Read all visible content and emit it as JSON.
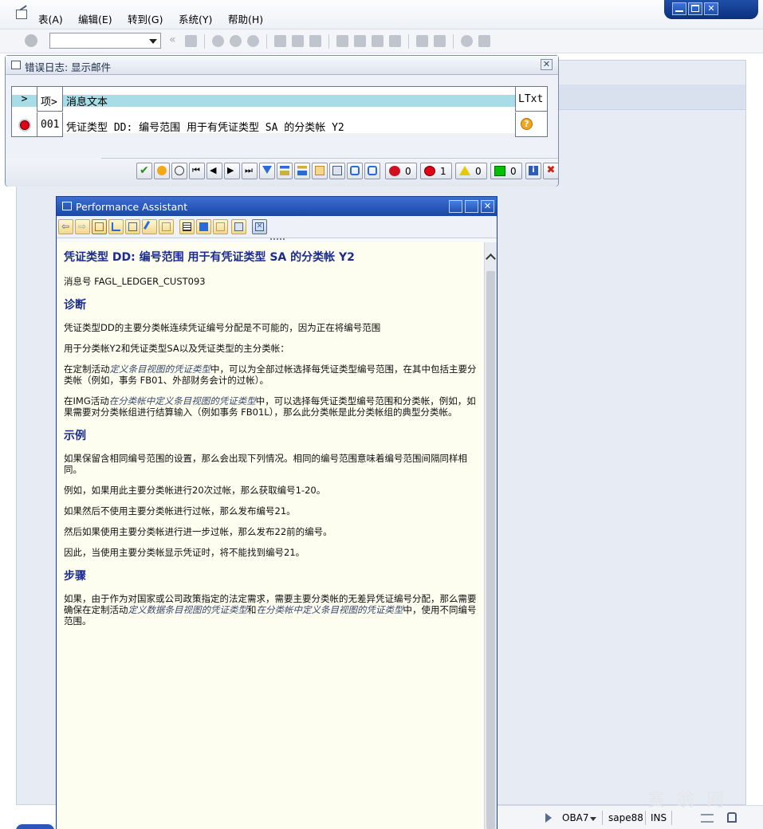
{
  "menubar": {
    "items": [
      "表(A)",
      "编辑(E)",
      "转到(G)",
      "系统(Y)",
      "帮助(H)"
    ]
  },
  "toolbar": {
    "command_field_value": "",
    "arrows": "«"
  },
  "error_dialog": {
    "title": "错误日志: 显示邮件",
    "close": "✕",
    "columns": [
      ">",
      "项>",
      "消息文本",
      "LTxt"
    ],
    "rows": [
      {
        "item": "001",
        "text": "凭证类型 DD: 编号范围  用于有凭证类型 SA 的分类帐 Y2",
        "status": "error"
      }
    ],
    "counters": {
      "stop": "0",
      "error": "1",
      "warning": "0",
      "success": "0"
    },
    "status_colors": {
      "error": "#e00018",
      "warning": "#ffe600",
      "success": "#00c000"
    }
  },
  "performance_assistant": {
    "title": "Performance Assistant",
    "heading": "凭证类型 DD: 编号范围 用于有凭证类型 SA 的分类帐 Y2",
    "message_no": "消息号 FAGL_LEDGER_CUST093",
    "sections": {
      "diagnosis_title": "诊断",
      "diag_p1": "凭证类型DD的主要分类帐连续凭证编号分配是不可能的，因为正在将编号范围",
      "diag_p2": "用于分类帐Y2和凭证类型SA以及凭证类型的主分类帐：",
      "diag_p3_a": "在定制活动",
      "diag_p3_link": "定义条目视图的凭证类型",
      "diag_p3_b": "中，可以为全部过帐选择每凭证类型编号范围，在其中包括主要分类帐（例如，事务 FB01、外部财务会计的过帐）。",
      "diag_p4_a": "在IMG活动",
      "diag_p4_link": "在分类帐中定义条目视图的凭证类型",
      "diag_p4_b": "中，可以选择每凭证类型编号范围和分类帐，例如，如果需要对分类帐组进行结算输入（例如事务 FB01L），那么此分类帐是此分类帐组的典型分类帐。",
      "example_title": "示例",
      "ex_p1": "如果保留含相同编号范围的设置，那么会出现下列情况。相同的编号范围意味着编号范围间隔同样相同。",
      "ex_p2": "例如，如果用此主要分类帐进行20次过帐，那么获取编号1-20。",
      "ex_p3": "如果然后不使用主要分类帐进行过帐，那么发布编号21。",
      "ex_p4": "然后如果使用主要分类帐进行进一步过帐，那么发布22前的编号。",
      "ex_p5": "因此，当使用主要分类帐显示凭证时，将不能找到编号21。",
      "procedure_title": "步骤",
      "proc_p1_a": "如果，由于作为对国家或公司政策指定的法定需求，需要主要分类帐的无差异凭证编号分配，那么需要确保在定制活动",
      "proc_p1_link1": "定义数据条目视图的凭证类型",
      "proc_p1_b": "和",
      "proc_p1_link2": "在分类帐中定义条目视图的凭证类型",
      "proc_p1_c": "中，使用不同编号范围。"
    }
  },
  "statusbar": {
    "transaction": "OBA7",
    "server": "sape88",
    "mode": "INS"
  },
  "watermark": "赛 翁 网"
}
